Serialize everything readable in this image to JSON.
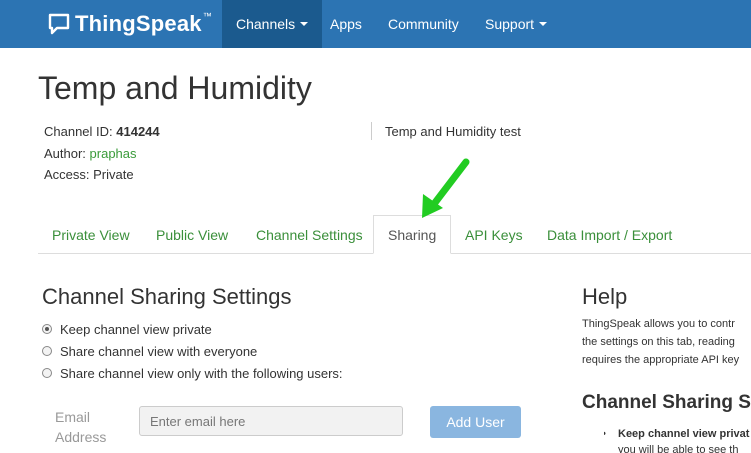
{
  "navbar": {
    "brand": "ThingSpeak",
    "brand_tm": "™",
    "items": [
      {
        "label": "Channels",
        "has_caret": true,
        "active": true
      },
      {
        "label": "Apps",
        "has_caret": false,
        "active": false
      },
      {
        "label": "Community",
        "has_caret": false,
        "active": false
      },
      {
        "label": "Support",
        "has_caret": true,
        "active": false
      }
    ],
    "color": "#2c74b3",
    "active_color": "#1b5a8e"
  },
  "channel": {
    "title": "Temp and Humidity",
    "id_label": "Channel ID: ",
    "id_value": "414244",
    "author_label": "Author: ",
    "author_value": "praphas",
    "access_label": "Access: ",
    "access_value": "Private",
    "description": "Temp and Humidity test"
  },
  "tabs": [
    {
      "label": "Private View"
    },
    {
      "label": "Public View"
    },
    {
      "label": "Channel Settings"
    },
    {
      "label": "Sharing",
      "active": true
    },
    {
      "label": "API Keys"
    },
    {
      "label": "Data Import / Export"
    }
  ],
  "sharing": {
    "title": "Channel Sharing Settings",
    "options": [
      {
        "label": "Keep channel view private",
        "checked": true
      },
      {
        "label": "Share channel view with everyone",
        "checked": false
      },
      {
        "label": "Share channel view only with the following users:",
        "checked": false
      }
    ],
    "email_label_line1": "Email",
    "email_label_line2": "Address",
    "email_placeholder": "Enter email here",
    "add_button": "Add User"
  },
  "help": {
    "title": "Help",
    "line1": "ThingSpeak allows you to contr",
    "line2": "the settings on this tab, reading",
    "line3": "requires the appropriate API key",
    "subtitle": "Channel Sharing Se",
    "bullet": "Keep channel view privat",
    "bullet_cont": "you will be able to see th"
  },
  "annotation": {
    "arrow_color": "#22cc22",
    "arrow_icon": "green-arrow-icon"
  },
  "colors": {
    "link_green": "#3a9b3a",
    "button_blue": "#8ab6e0"
  }
}
